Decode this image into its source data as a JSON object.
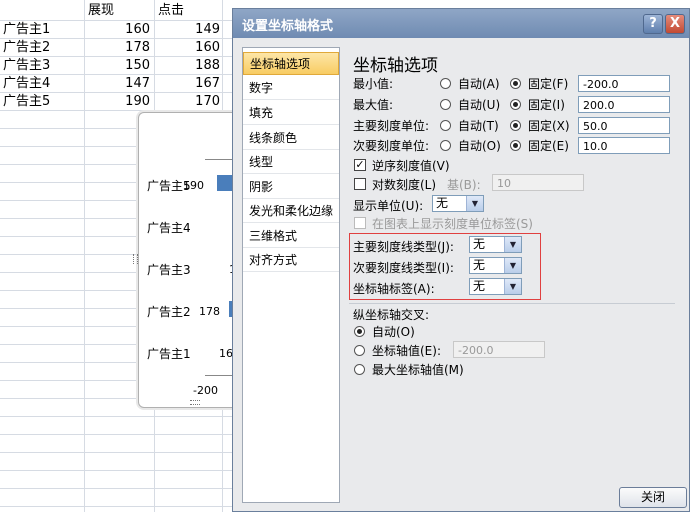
{
  "sheet": {
    "headers": [
      "展现",
      "点击"
    ],
    "rows": [
      {
        "name": "广告主1",
        "impressions": "160",
        "clicks": "149"
      },
      {
        "name": "广告主2",
        "impressions": "178",
        "clicks": "160"
      },
      {
        "name": "广告主3",
        "impressions": "150",
        "clicks": "188"
      },
      {
        "name": "广告主4",
        "impressions": "147",
        "clicks": "167"
      },
      {
        "name": "广告主5",
        "impressions": "190",
        "clicks": "170"
      }
    ]
  },
  "chart": {
    "categories": [
      "广告主5",
      "广告主4",
      "广告主3",
      "广告主2",
      "广告主1"
    ],
    "data_labels": [
      "190",
      "",
      "1",
      "178",
      "16"
    ],
    "x_tick": "-200",
    "bar_color": "#4a7ebb"
  },
  "dialog": {
    "title": "设置坐标轴格式",
    "help": "?",
    "close_x": "X",
    "nav": [
      "坐标轴选项",
      "数字",
      "填充",
      "线条颜色",
      "线型",
      "阴影",
      "发光和柔化边缘",
      "三维格式",
      "对齐方式"
    ],
    "panel_title": "坐标轴选项",
    "min": {
      "label": "最小值:",
      "auto": "自动(A)",
      "fixed": "固定(F)",
      "value": "-200.0"
    },
    "max": {
      "label": "最大值:",
      "auto": "自动(U)",
      "fixed": "固定(I)",
      "value": "200.0"
    },
    "major": {
      "label": "主要刻度单位:",
      "auto": "自动(T)",
      "fixed": "固定(X)",
      "value": "50.0"
    },
    "minor": {
      "label": "次要刻度单位:",
      "auto": "自动(O)",
      "fixed": "固定(E)",
      "value": "10.0"
    },
    "reverse": "逆序刻度值(V)",
    "log": "对数刻度(L)",
    "log_base_label": "基(B):",
    "log_base": "10",
    "display_units_label": "显示单位(U):",
    "display_units": "无",
    "show_units_label": "在图表上显示刻度单位标签(S)",
    "major_tick_label": "主要刻度线类型(J):",
    "major_tick": "无",
    "minor_tick_label": "次要刻度线类型(I):",
    "minor_tick": "无",
    "axis_label_label": "坐标轴标签(A):",
    "axis_label": "无",
    "cross_title": "纵坐标轴交叉:",
    "cross_auto": "自动(O)",
    "cross_value_label": "坐标轴值(E):",
    "cross_value": "-200.0",
    "cross_max": "最大坐标轴值(M)",
    "close_button": "关闭"
  }
}
